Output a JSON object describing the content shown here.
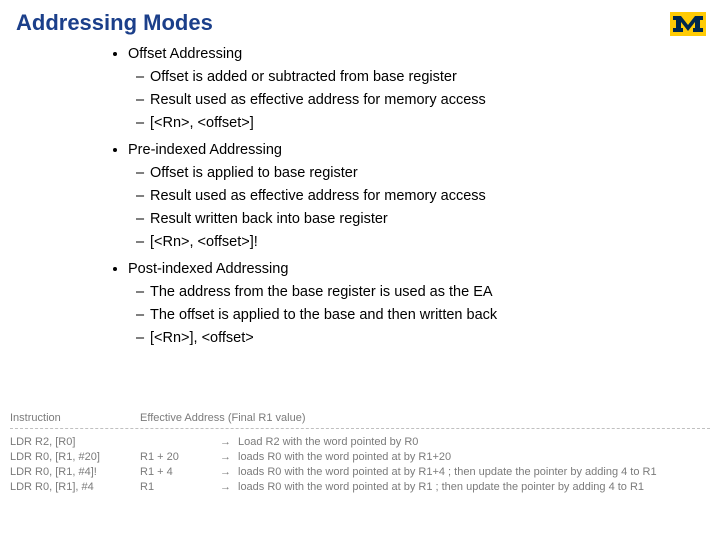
{
  "title": "Addressing Modes",
  "sections": [
    {
      "heading": "Offset Addressing",
      "items": [
        "Offset is added or subtracted from base register",
        "Result used as effective address for memory access",
        "[<Rn>, <offset>]"
      ]
    },
    {
      "heading": "Pre-indexed Addressing",
      "items": [
        "Offset is applied to base register",
        "Result used as effective address for memory access",
        "Result written back into base register",
        "[<Rn>, <offset>]!"
      ]
    },
    {
      "heading": "Post-indexed Addressing",
      "items": [
        "The address from the base register is used as the EA",
        "The offset is applied to the base and then written back",
        "[<Rn>], <offset>"
      ]
    }
  ],
  "table": {
    "header": {
      "c1": "Instruction",
      "c2": "Effective Address (Final R1 value)"
    },
    "rows": [
      {
        "instr": "LDR R2, [R0]",
        "ea": "",
        "arrow": "→",
        "desc": "Load R2 with the word pointed by R0"
      },
      {
        "instr": "LDR R0, [R1, #20]",
        "ea": "R1 + 20",
        "arrow": "→",
        "desc": "loads R0 with the word pointed at by R1+20"
      },
      {
        "instr": "LDR R0, [R1, #4]!",
        "ea": "R1 + 4",
        "arrow": "→",
        "desc": "loads R0 with the word pointed at by R1+4 ; then update the pointer by adding 4 to R1"
      },
      {
        "instr": "LDR R0, [R1], #4",
        "ea": "R1",
        "arrow": "→",
        "desc": "loads R0 with the word pointed at by R1 ; then update the pointer by adding 4 to R1"
      }
    ]
  }
}
